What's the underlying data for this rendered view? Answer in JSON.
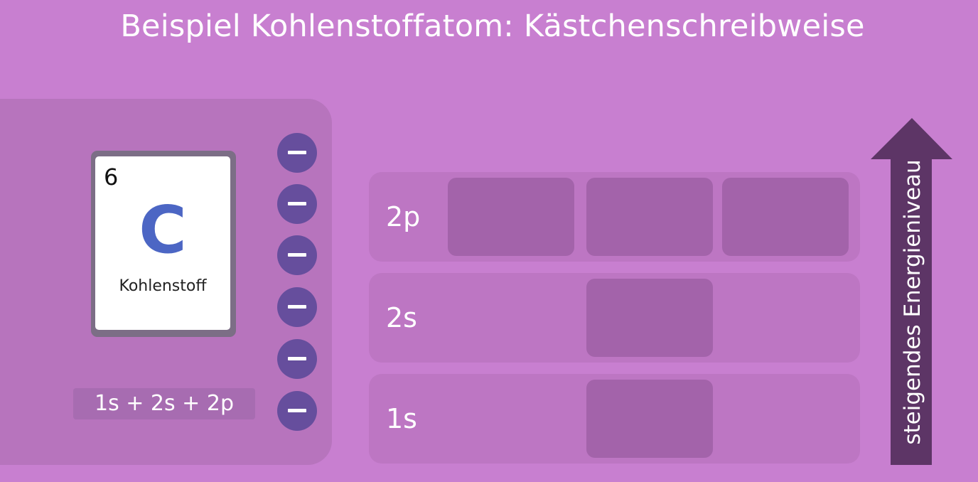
{
  "title": "Beispiel Kohlenstoffatom: Kästchenschreibweise",
  "element": {
    "number": "6",
    "symbol": "C",
    "name": "Kohlenstoff",
    "symbol_color": "#4c66c4"
  },
  "configuration": "1s + 2s + 2p",
  "electrons": {
    "count": 6,
    "icon": "minus-icon",
    "color": "#664e9d"
  },
  "orbitals": [
    {
      "label": "2p",
      "boxes": 3
    },
    {
      "label": "2s",
      "boxes": 1
    },
    {
      "label": "1s",
      "boxes": 1
    }
  ],
  "energy_axis": {
    "label": "steigendes Energieniveau",
    "icon": "arrow-up-icon",
    "color": "#5d3566"
  },
  "colors": {
    "background": "#c87fd0",
    "panel": "#b774bd",
    "orbital_row": "#bd76c3",
    "orbital_box": "#a363aa"
  }
}
